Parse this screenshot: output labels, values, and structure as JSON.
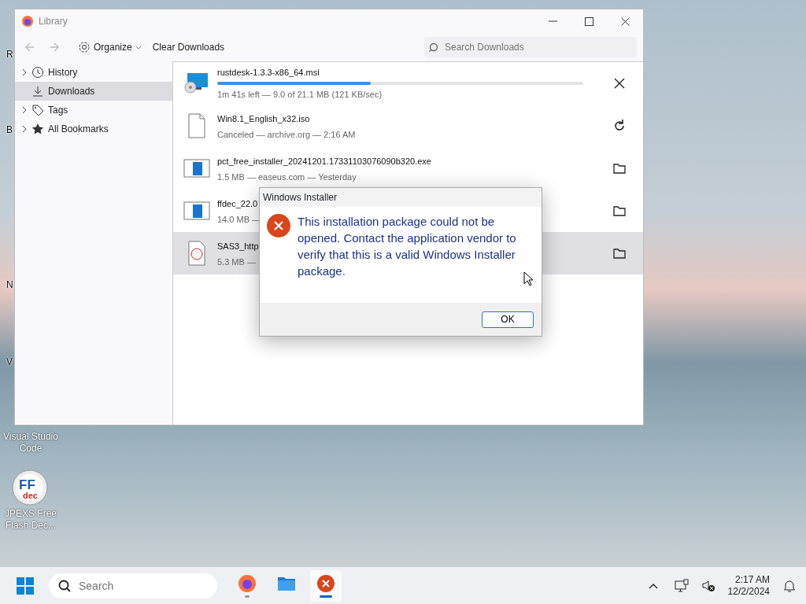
{
  "desktop": {
    "icons": [
      {
        "label": "Visual Studio Code"
      },
      {
        "label": "JPEXS Free Flash Dec...",
        "logo_text": [
          "FF",
          "dec"
        ]
      }
    ],
    "fragments": [
      "R",
      "B",
      "N",
      "V"
    ]
  },
  "window": {
    "title": "Library"
  },
  "toolbar": {
    "back": {
      "disabled": true
    },
    "forward": {
      "disabled": true
    },
    "organize": "Organize",
    "clear": "Clear Downloads",
    "search": {
      "placeholder": "Search Downloads"
    }
  },
  "sidebar": {
    "items": [
      {
        "label": "History",
        "kind": "expandable",
        "selected": false
      },
      {
        "label": "Downloads",
        "kind": "plain",
        "selected": true
      },
      {
        "label": "Tags",
        "kind": "expandable",
        "selected": false
      },
      {
        "label": "All Bookmarks",
        "kind": "expandable",
        "selected": false
      }
    ]
  },
  "downloads": [
    {
      "name": "rustdesk-1.3.3-x86_64.msi",
      "kind": "active",
      "level": 0.42,
      "status": "1m 41s left — 9.0 of 21.1 MB (121 KB/sec)",
      "selected": false
    },
    {
      "name": "Win8.1_English_x32.iso",
      "kind": "canceled",
      "status": "Canceled — archive.org — 2:16 AM",
      "selected": false
    },
    {
      "name": "pct_free_installer_20241201.17331103076090b320.exe",
      "kind": "done",
      "status": "1.5 MB — easeus.com — Yesterday",
      "selected": false
    },
    {
      "name": "ffdec_22.0",
      "kind": "done",
      "status": "14.0 MB —",
      "selected": false
    },
    {
      "name": "SAS3_http",
      "kind": "done",
      "status": "5.3 MB —",
      "selected": true
    }
  ],
  "dialog": {
    "title": "Windows Installer",
    "message": "This installation package could not be opened.  Contact the application vendor to verify that this is a valid Windows Installer package.",
    "button": "OK"
  },
  "taskbar": {
    "search": {
      "placeholder": "Search"
    },
    "apps": [
      {
        "running": true,
        "selected": false
      },
      {
        "running": false,
        "selected": false
      },
      {
        "running": true,
        "selected": true
      }
    ],
    "time": "2:17 AM",
    "date": "12/2/2024"
  }
}
